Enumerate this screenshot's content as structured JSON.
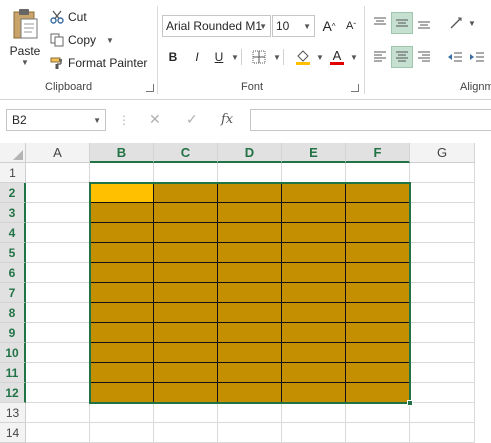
{
  "clipboard": {
    "paste_label": "Paste",
    "cut_label": "Cut",
    "copy_label": "Copy",
    "format_painter_label": "Format Painter",
    "group_label": "Clipboard"
  },
  "font": {
    "font_name": "Arial Rounded M1",
    "font_size": "10",
    "bold_label": "B",
    "italic_label": "I",
    "underline_label": "U",
    "grow_label": "A",
    "shrink_label": "A",
    "font_color_label": "A",
    "group_label": "Font"
  },
  "alignment": {
    "group_label": "Alignm"
  },
  "name_box": {
    "value": "B2"
  },
  "formula": {
    "fx_label": "fx",
    "value": ""
  },
  "sheet": {
    "columns": [
      "A",
      "B",
      "C",
      "D",
      "E",
      "F",
      "G"
    ],
    "rows": [
      "1",
      "2",
      "3",
      "4",
      "5",
      "6",
      "7",
      "8",
      "9",
      "10",
      "11",
      "12",
      "13",
      "14"
    ],
    "selected_columns": [
      "B",
      "C",
      "D",
      "E",
      "F"
    ],
    "selected_rows": [
      "2",
      "3",
      "4",
      "5",
      "6",
      "7",
      "8",
      "9",
      "10",
      "11",
      "12"
    ],
    "active_cell": "B2",
    "fill_color": "#c48f00",
    "active_cell_color": "#ffc000",
    "selection_color": "#217346"
  }
}
